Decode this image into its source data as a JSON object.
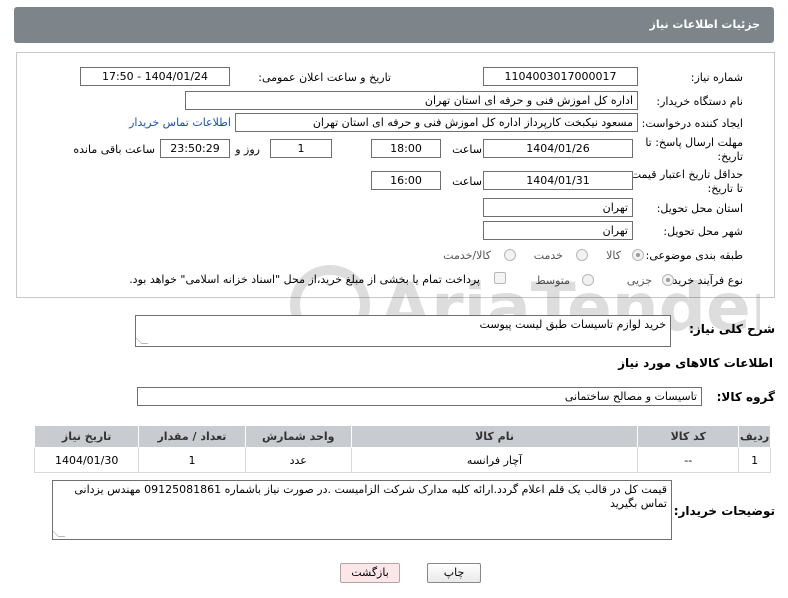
{
  "header": {
    "title": "جزئیات اطلاعات نیاز"
  },
  "form": {
    "need_number_label": "شماره نیاز:",
    "need_number": "1104003017000017",
    "announce_label": "تاریخ و ساعت اعلان عمومی:",
    "announce_value": "1404/01/24 - 17:50",
    "buyer_org_label": "نام دستگاه خریدار:",
    "buyer_org": "اداره کل اموزش فنی و حرفه ای استان تهران",
    "creator_label": "ایجاد کننده درخواست:",
    "creator": "مسعود نیکبخت کارپرداز اداره کل اموزش فنی و حرفه ای استان تهران",
    "contact_link": "اطلاعات تماس خریدار",
    "deadline_label_1": "مهلت ارسال پاسخ: تا",
    "deadline_label_2": "تاریخ:",
    "deadline_date": "1404/01/26",
    "time_label": "ساعت",
    "deadline_time": "18:00",
    "days_value": "1",
    "days_label": "روز و",
    "remaining_time": "23:50:29",
    "remaining_label": "ساعت باقی مانده",
    "min_validity_label_1": "حداقل تاریخ اعتبار قیمت:",
    "min_validity_label_2": "تا تاریخ:",
    "validity_date": "1404/01/31",
    "validity_time": "16:00",
    "delivery_province_label": "استان محل تحویل:",
    "delivery_province": "تهران",
    "delivery_city_label": "شهر محل تحویل:",
    "delivery_city": "تهران",
    "category_label": "طبقه بندی موضوعی:",
    "category_options": [
      "کالا",
      "خدمت",
      "کالا/خدمت"
    ],
    "category_selected": "کالا",
    "process_label": "نوع فرآیند خرید :",
    "process_options": [
      "جزیی",
      "متوسط"
    ],
    "process_selected": "جزیی",
    "payment_note": "پرداخت تمام یا بخشی از مبلغ خرید،از محل \"اسناد خزانه اسلامی\" خواهد بود."
  },
  "description": {
    "label": "شرح کلی نیاز:",
    "value": "خرید لوازم تاسیسات طبق لیست پیوست"
  },
  "goods": {
    "section_title": "اطلاعات کالاهای مورد نیاز",
    "group_label": "گروه کالا:",
    "group_value": "تاسیسات و مصالح ساختمانی",
    "columns": [
      "ردیف",
      "کد کالا",
      "نام کالا",
      "واحد شمارش",
      "تعداد / مقدار",
      "تاریخ نیاز"
    ],
    "rows": [
      [
        "1",
        "--",
        "آچار فرانسه",
        "عدد",
        "1",
        "1404/01/30"
      ]
    ]
  },
  "buyer_notes": {
    "label": "توضیحات خریدار:",
    "value": "قیمت کل در قالب یک قلم اعلام گردد.ارائه کلیه مدارک شرکت الزامیست .در صورت نیاز باشماره 09125081861 مهندس یزدانی تماس بگیرید"
  },
  "buttons": {
    "print": "چاپ",
    "back": "بازگشت"
  },
  "watermark": {
    "text": "AriaTender.neT",
    "color": "#000000"
  },
  "colors": {
    "header": "#7d858a",
    "link": "#1a4fb3",
    "table_header": "#c8ccd0",
    "back_button": "#fbe6e8"
  }
}
